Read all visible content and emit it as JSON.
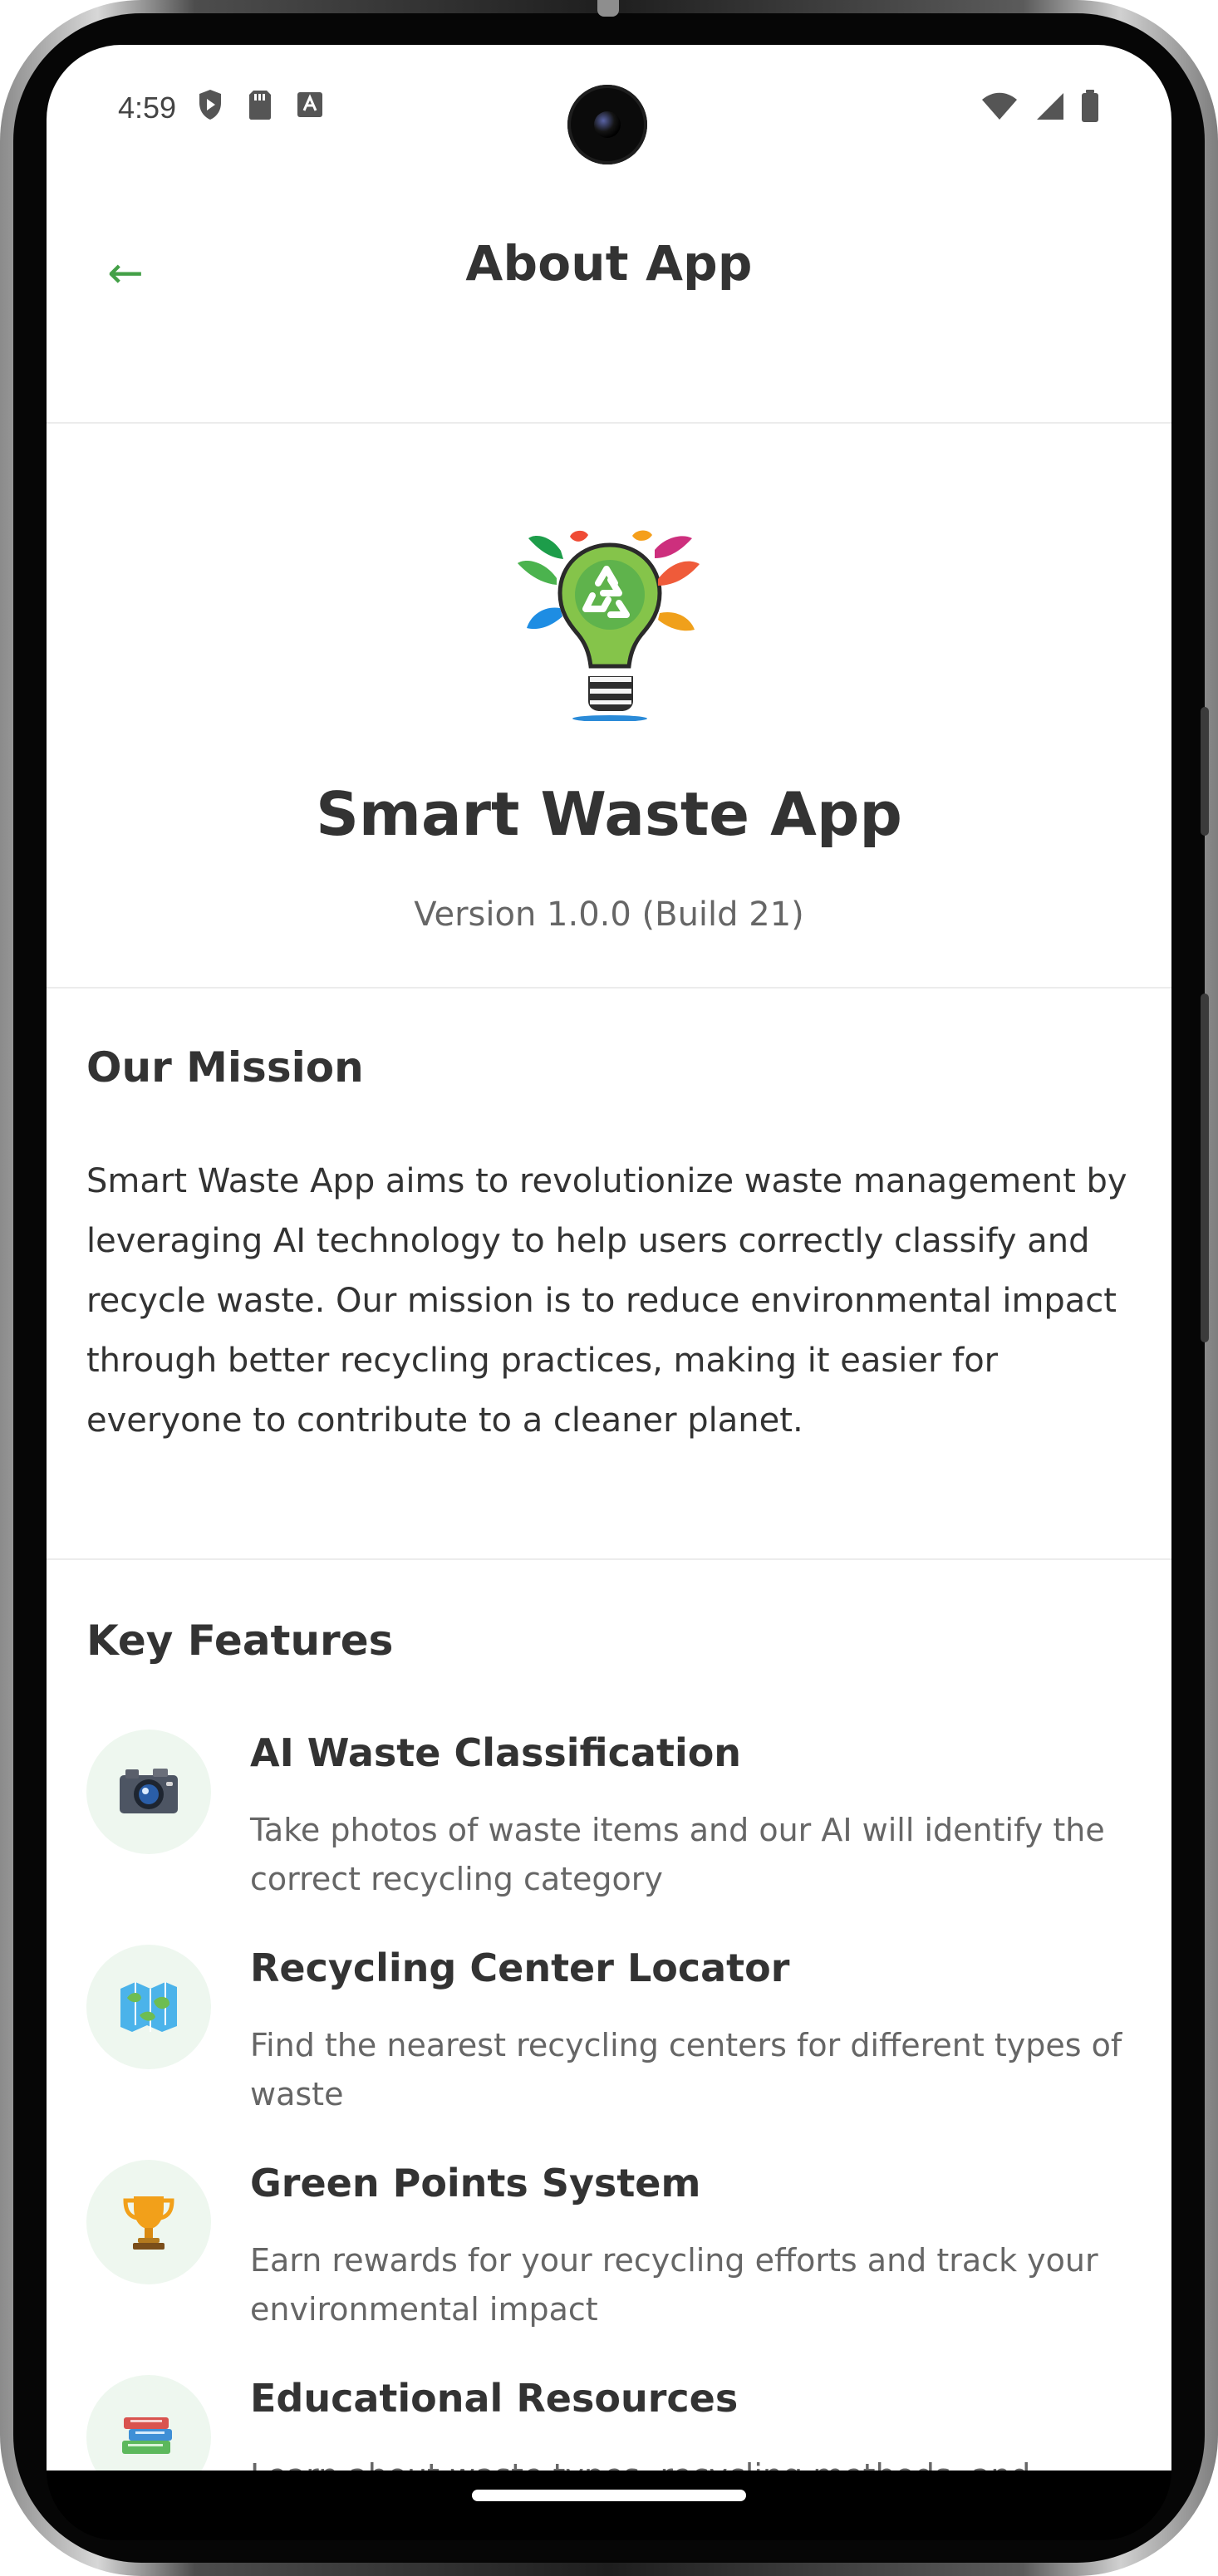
{
  "status_bar": {
    "time": "4:59",
    "left_icons": [
      "shield-icon",
      "sd-card-icon",
      "text-box-icon"
    ],
    "right_icons": [
      "wifi-icon",
      "signal-icon",
      "battery-icon"
    ]
  },
  "header": {
    "back_icon": "←",
    "title": "About App"
  },
  "hero": {
    "logo": "smart-waste-lightbulb-logo",
    "app_name": "Smart Waste App",
    "version": "Version 1.0.0 (Build 21)"
  },
  "mission": {
    "title": "Our Mission",
    "text": "Smart Waste App aims to revolutionize waste management by leveraging AI technology to help users correctly classify and recycle waste. Our mission is to reduce environmental impact through better recycling practices, making it easier for everyone to contribute to a cleaner planet."
  },
  "features": {
    "title": "Key Features",
    "items": [
      {
        "icon": "camera-icon",
        "title": "AI Waste Classification",
        "description": "Take photos of waste items and our AI will identify the correct recycling category"
      },
      {
        "icon": "map-icon",
        "title": "Recycling Center Locator",
        "description": "Find the nearest recycling centers for different types of waste"
      },
      {
        "icon": "trophy-icon",
        "title": "Green Points System",
        "description": "Earn rewards for your recycling efforts and track your environmental impact"
      },
      {
        "icon": "books-icon",
        "title": "Educational Resources",
        "description": "Learn about waste types, recycling methods, and"
      }
    ]
  },
  "colors": {
    "accent_green": "#43a047",
    "text_primary": "#333333",
    "text_secondary": "#666666",
    "icon_bg": "#eef7ef",
    "divider": "#ececec"
  }
}
